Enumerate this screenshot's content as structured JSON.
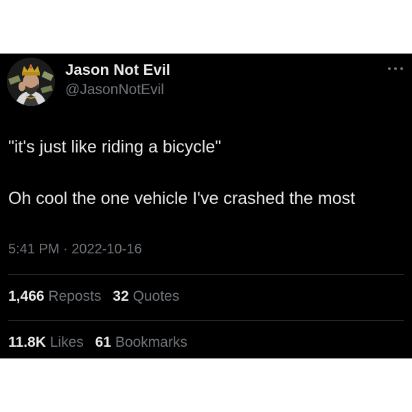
{
  "author": {
    "display_name": "Jason Not Evil",
    "handle": "@JasonNotEvil",
    "avatar_icon": "user-avatar"
  },
  "tweet": {
    "lines": [
      "\"it's just like riding a bicycle\"",
      "Oh cool the one vehicle I've crashed the most"
    ]
  },
  "meta": {
    "time": "5:41 PM",
    "separator": "·",
    "date": "2022-10-16"
  },
  "stats": {
    "reposts_count": "1,466",
    "reposts_label": "Reposts",
    "quotes_count": "32",
    "quotes_label": "Quotes",
    "likes_count": "11.8K",
    "likes_label": "Likes",
    "bookmarks_count": "61",
    "bookmarks_label": "Bookmarks"
  },
  "colors": {
    "background": "#000000",
    "primary_text": "#e7e9ea",
    "secondary_text": "#71767b",
    "divider": "#2f3336"
  }
}
